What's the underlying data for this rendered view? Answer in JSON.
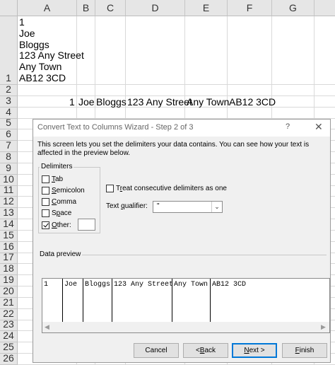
{
  "sheet": {
    "columns": [
      "A",
      "B",
      "C",
      "D",
      "E",
      "F",
      "G"
    ],
    "rows": [
      "1",
      "2",
      "3",
      "4",
      "5",
      "6",
      "7",
      "8",
      "9",
      "10",
      "11",
      "12",
      "13",
      "14",
      "15",
      "16",
      "17",
      "18",
      "19",
      "20",
      "21",
      "22",
      "23",
      "24",
      "25",
      "26"
    ],
    "a1_lines": [
      "1",
      "Joe",
      "Bloggs",
      "123 Any Street",
      "Any Town",
      "AB12 3CD"
    ],
    "row3": {
      "a": "1",
      "b": "Joe",
      "c": "Bloggs",
      "d": "123 Any Street",
      "e": "Any Town",
      "f": "AB12 3CD"
    }
  },
  "dialog": {
    "title": "Convert Text to Columns Wizard - Step 2 of 3",
    "help": "?",
    "close": "✕",
    "description": "This screen lets you set the delimiters your data contains.  You can see how your text is affected in the preview below.",
    "delimiters": {
      "label": "Delimiters",
      "tab": {
        "pre": "",
        "acc": "T",
        "post": "ab",
        "checked": false
      },
      "semicolon": {
        "pre": "",
        "acc": "S",
        "post": "emicolon",
        "checked": false
      },
      "comma": {
        "pre": "",
        "acc": "C",
        "post": "omma",
        "checked": false
      },
      "space": {
        "pre": "S",
        "acc": "p",
        "post": "ace",
        "checked": false
      },
      "other": {
        "pre": "",
        "acc": "O",
        "post": "ther:",
        "checked": true,
        "value": ""
      }
    },
    "treat_consecutive": {
      "pre": "T",
      "acc": "r",
      "post": "eat consecutive delimiters as one",
      "checked": false
    },
    "qualifier": {
      "pre": "Text ",
      "acc": "q",
      "post": "ualifier:",
      "value": "\""
    },
    "preview": {
      "label": "Data preview",
      "cells": [
        "1",
        "Joe",
        "Bloggs",
        "123 Any Street",
        "Any Town",
        "AB12 3CD"
      ]
    },
    "buttons": {
      "cancel": "Cancel",
      "back": {
        "pre": "< ",
        "acc": "B",
        "post": "ack"
      },
      "next": {
        "acc": "N",
        "post": "ext >"
      },
      "finish": {
        "acc": "F",
        "post": "inish"
      }
    }
  }
}
